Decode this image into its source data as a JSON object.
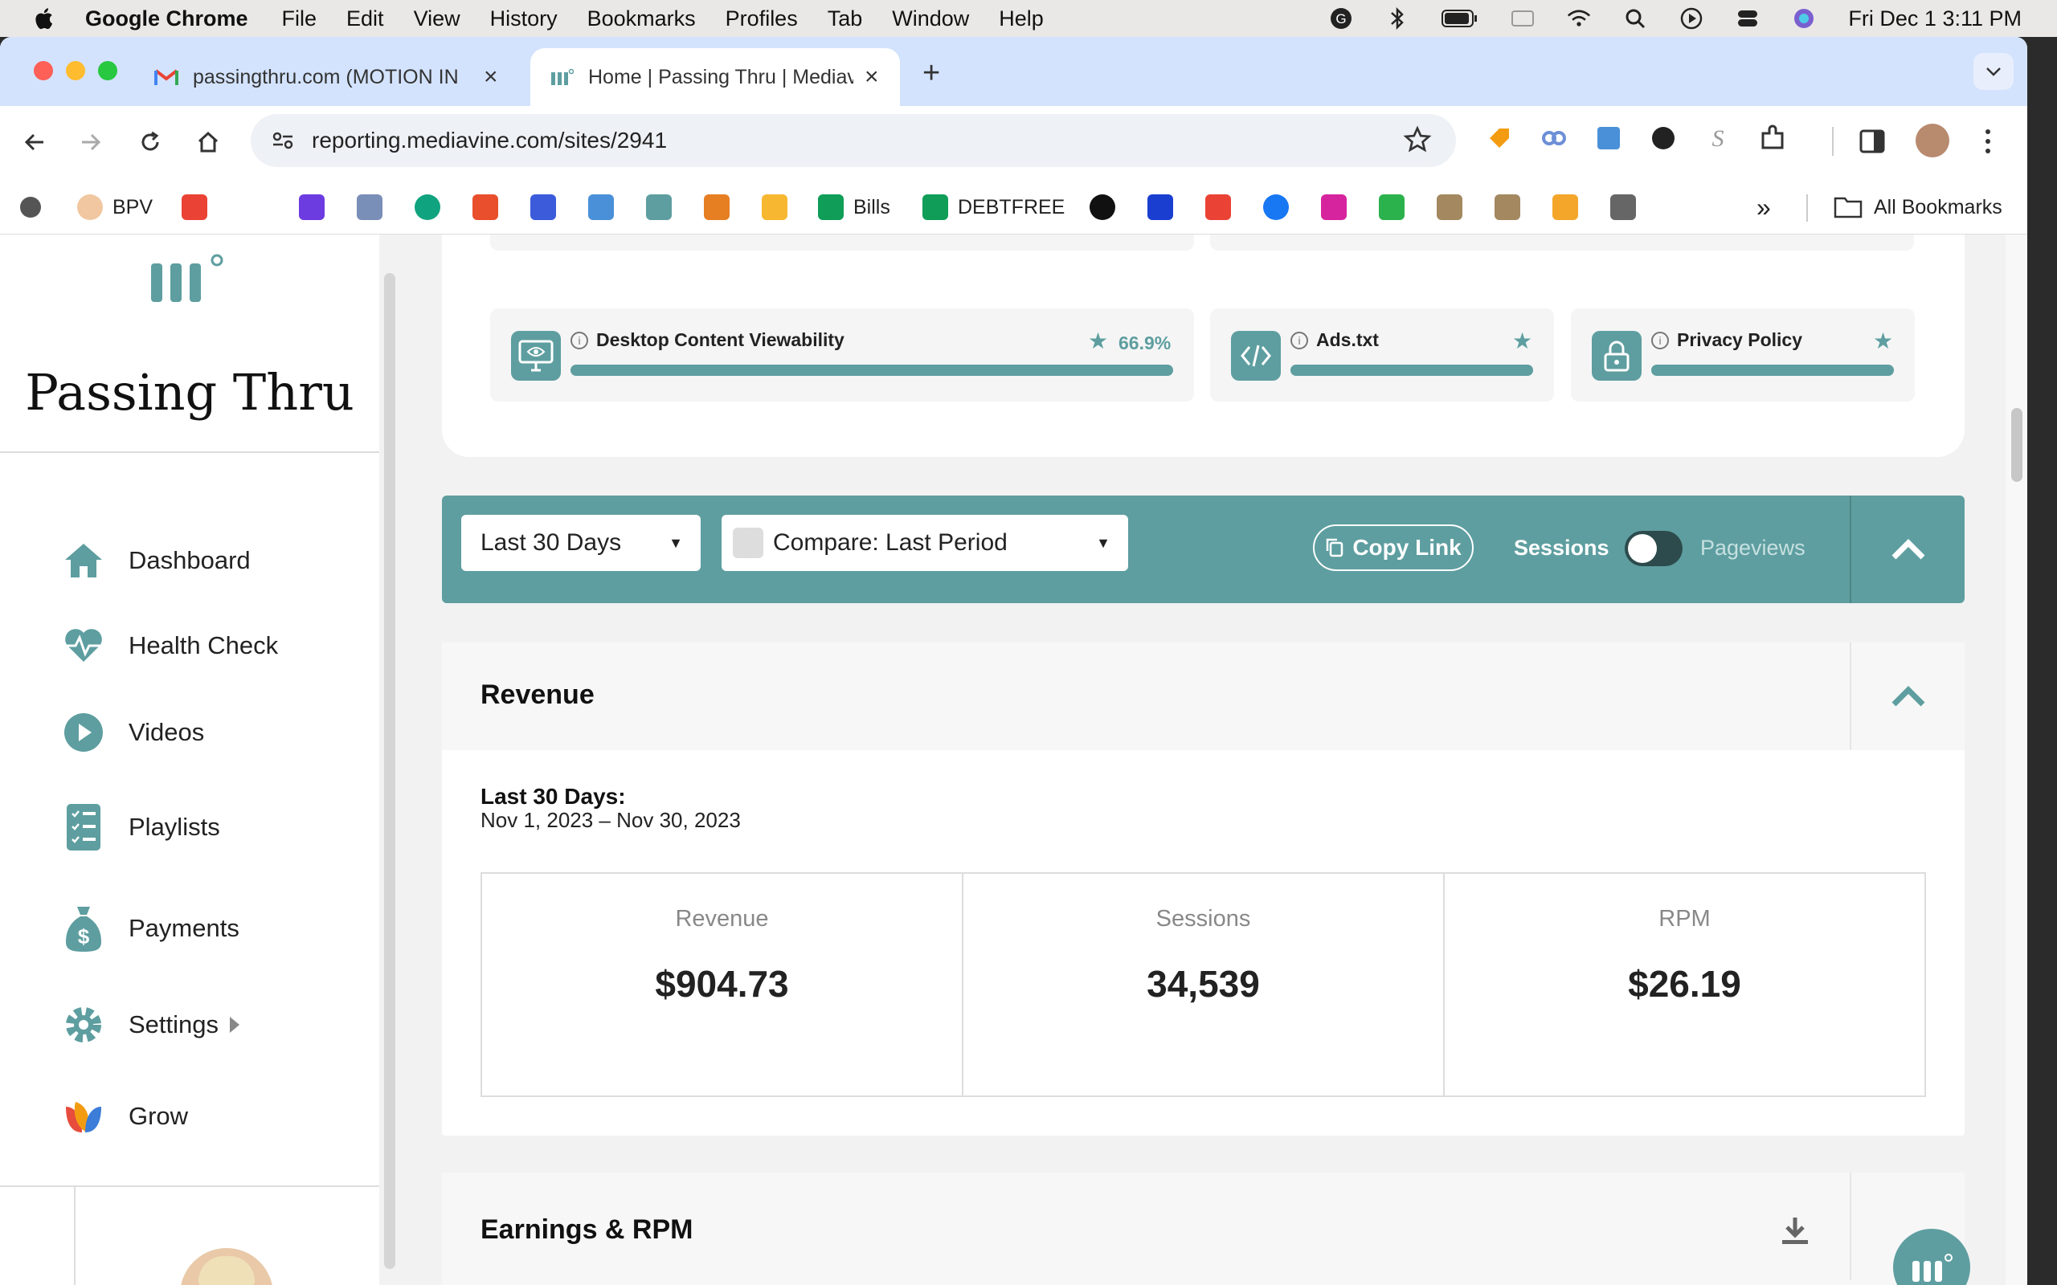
{
  "menubar": {
    "app": "Google Chrome",
    "items": [
      "File",
      "Edit",
      "View",
      "History",
      "Bookmarks",
      "Profiles",
      "Tab",
      "Window",
      "Help"
    ],
    "clock": "Fri Dec 1  3:11 PM"
  },
  "tabs": [
    {
      "title": "passingthru.com (MOTION IN"
    },
    {
      "title": "Home | Passing Thru | Mediavine"
    }
  ],
  "address": {
    "url": "reporting.mediavine.com/sites/2941"
  },
  "bookmarks": {
    "bpv": "BPV",
    "bills": "Bills",
    "debtfree": "DEBTFREE",
    "all": "All Bookmarks"
  },
  "sidebar": {
    "site_name": "Passing Thru",
    "nav": [
      {
        "label": "Dashboard"
      },
      {
        "label": "Health Check"
      },
      {
        "label": "Videos"
      },
      {
        "label": "Playlists"
      },
      {
        "label": "Payments"
      },
      {
        "label": "Settings"
      },
      {
        "label": "Grow"
      }
    ]
  },
  "health": {
    "viewability": {
      "label": "Desktop Content Viewability",
      "value": "66.9%",
      "fill": 0.669
    },
    "adstxt": {
      "label": "Ads.txt"
    },
    "privacy": {
      "label": "Privacy Policy"
    }
  },
  "filters": {
    "range": "Last 30 Days",
    "compare": "Compare: Last Period",
    "copy_link": "Copy Link",
    "sessions": "Sessions",
    "pageviews": "Pageviews"
  },
  "revenue": {
    "title": "Revenue",
    "period_label": "Last 30 Days:",
    "period_range": "Nov 1, 2023 – Nov 30, 2023",
    "metrics": [
      {
        "label": "Revenue",
        "value": "$904.73"
      },
      {
        "label": "Sessions",
        "value": "34,539"
      },
      {
        "label": "RPM",
        "value": "$26.19"
      }
    ]
  },
  "earnings": {
    "title": "Earnings & RPM"
  },
  "colors": {
    "teal": "#5e9ea0",
    "tabstrip": "#d3e3fd"
  }
}
